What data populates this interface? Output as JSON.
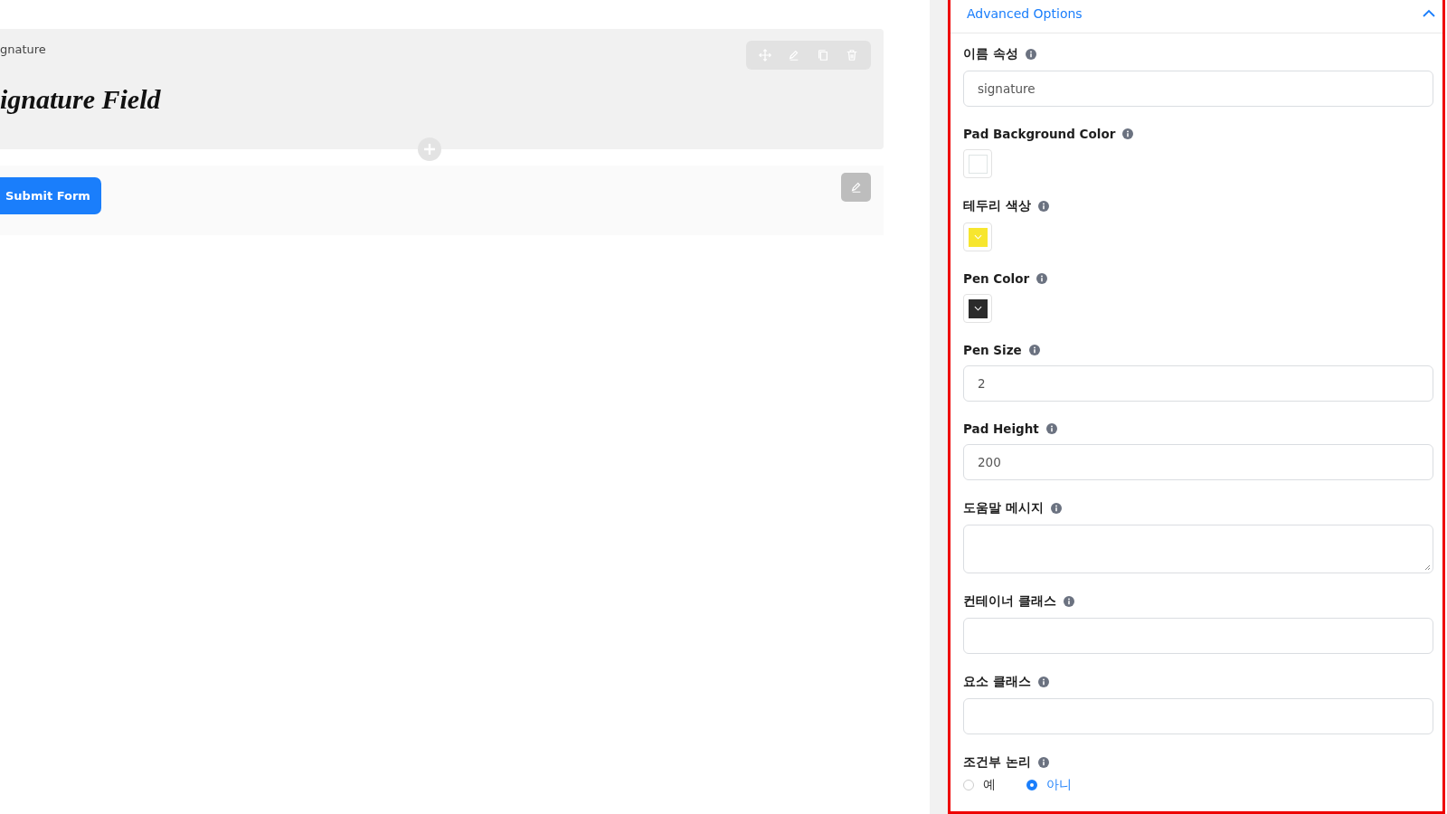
{
  "canvas": {
    "field_label": "gnature",
    "signature_text": "ignature Field",
    "submit_button": "Submit Form"
  },
  "panel": {
    "title": "Advanced Options",
    "expanded": true,
    "fields": [
      {
        "kind": "text",
        "label": "이름 속성",
        "value": "signature"
      },
      {
        "kind": "color",
        "label": "Pad Background Color",
        "color": "#ffffff"
      },
      {
        "kind": "color",
        "label": "테두리 색상",
        "color": "#f7e62e"
      },
      {
        "kind": "color",
        "label": "Pen Color",
        "color": "#2b2b2b"
      },
      {
        "kind": "text",
        "label": "Pen Size",
        "value": "2"
      },
      {
        "kind": "text",
        "label": "Pad Height",
        "value": "200"
      },
      {
        "kind": "textarea",
        "label": "도움말 메시지"
      },
      {
        "kind": "text",
        "label": "컨테이너 클래스"
      },
      {
        "kind": "text",
        "label": "요소 클래스"
      },
      {
        "kind": "radio",
        "label": "조건부 논리",
        "options": [
          {
            "label": "예",
            "selected": false
          },
          {
            "label": "아니",
            "selected": true
          }
        ]
      }
    ]
  }
}
